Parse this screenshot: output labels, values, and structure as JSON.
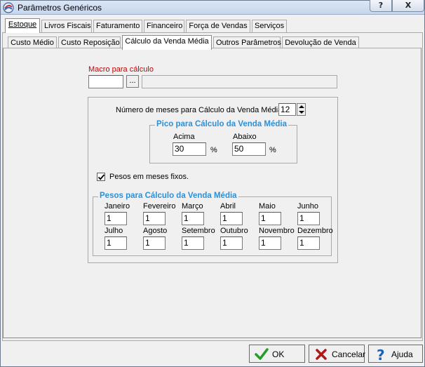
{
  "window": {
    "title": "Parâmetros Genéricos",
    "help_btn": "?",
    "close_btn": "X"
  },
  "tabs_main": [
    "Estoque",
    "Livros Fiscais",
    "Faturamento",
    "Financeiro",
    "Força de Vendas",
    "Serviços"
  ],
  "tabs_sub": [
    "Custo Médio",
    "Custo Reposição",
    "Cálculo da Venda Média",
    "Outros Parâmetros",
    "Devolução de Venda"
  ],
  "macro": {
    "label": "Macro para cálculo",
    "value": "",
    "btn": "...",
    "description": ""
  },
  "months_count": {
    "label": "Número de meses para Cálculo da Venda Média",
    "value": "12"
  },
  "pico": {
    "title": "Pico para Cálculo da Venda Média",
    "acima_label": "Acima",
    "acima_value": "30",
    "abaixo_label": "Abaixo",
    "abaixo_value": "50",
    "percent": "%"
  },
  "pesos_fixos": {
    "label": "Pesos em meses fixos.",
    "checked": true
  },
  "pesos": {
    "title": "Pesos para Cálculo da Venda Média",
    "months": [
      {
        "name": "Janeiro",
        "value": "1"
      },
      {
        "name": "Fevereiro",
        "value": "1"
      },
      {
        "name": "Março",
        "value": "1"
      },
      {
        "name": "Abril",
        "value": "1"
      },
      {
        "name": "Maio",
        "value": "1"
      },
      {
        "name": "Junho",
        "value": "1"
      },
      {
        "name": "Julho",
        "value": "1"
      },
      {
        "name": "Agosto",
        "value": "1"
      },
      {
        "name": "Setembro",
        "value": "1"
      },
      {
        "name": "Outubro",
        "value": "1"
      },
      {
        "name": "Novembro",
        "value": "1"
      },
      {
        "name": "Dezembro",
        "value": "1"
      }
    ]
  },
  "buttons": {
    "ok": "OK",
    "cancel": "Cancelar",
    "help": "Ajuda"
  },
  "colors": {
    "label_red": "#c80000",
    "frame_title_blue": "#2e8fd6",
    "ok_green": "#2a9a2a",
    "cancel_red": "#b01818",
    "help_blue": "#1e5fb8"
  }
}
